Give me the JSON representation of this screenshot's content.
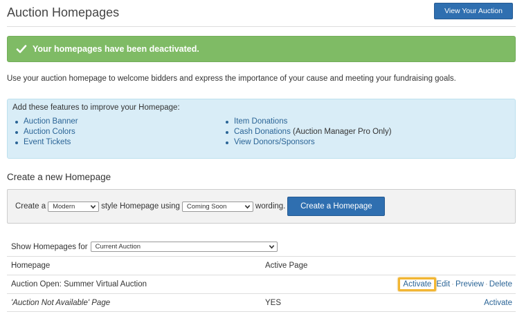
{
  "header": {
    "title": "Auction Homepages",
    "view_button": "View Your Auction"
  },
  "alert": {
    "message": "Your homepages have been deactivated.",
    "icon": "check-icon",
    "color": "#7fbb65"
  },
  "intro_text": "Use your auction homepage to welcome bidders and express the importance of your cause and meeting your fundraising goals.",
  "features": {
    "title": "Add these features to improve your Homepage:",
    "left": [
      "Auction Banner",
      "Auction Colors",
      "Event Tickets"
    ],
    "right": [
      {
        "label": "Item Donations",
        "note": ""
      },
      {
        "label": "Cash Donations",
        "note": " (Auction Manager Pro Only)"
      },
      {
        "label": "View Donors/Sponsors",
        "note": ""
      }
    ]
  },
  "create": {
    "section_title": "Create a new Homepage",
    "text_prefix": "Create a",
    "style_value": "Modern",
    "text_middle": "style Homepage using",
    "wording_value": "Coming Soon",
    "text_suffix": "wording.",
    "button": "Create a Homepage"
  },
  "filter": {
    "label": "Show Homepages for",
    "value": "Current Auction"
  },
  "table": {
    "headers": {
      "homepage": "Homepage",
      "active": "Active Page"
    },
    "rows": [
      {
        "homepage": "Auction Open: Summer Virtual Auction",
        "active": "",
        "actions": [
          "Activate",
          "Edit",
          "Preview",
          "Delete"
        ]
      },
      {
        "homepage": "'Auction Not Available' Page",
        "active": "YES",
        "actions": [
          "Activate"
        ]
      }
    ]
  },
  "colors": {
    "primary": "#2f6fb0",
    "link": "#2a6496",
    "info_bg": "#d9edf7",
    "highlight": "#f2b632"
  }
}
